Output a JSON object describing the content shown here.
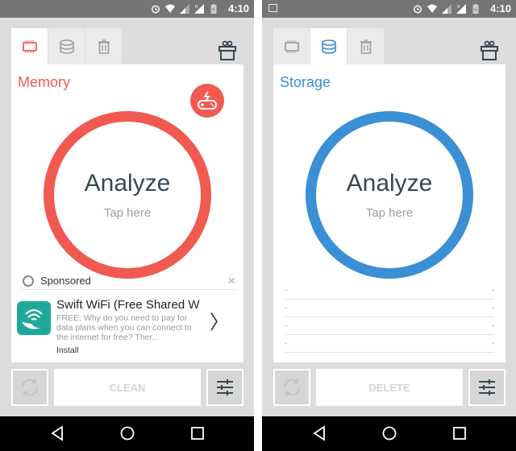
{
  "status_bar": {
    "time": "4:10",
    "battery_level": "26",
    "icons": [
      "alarm-icon",
      "wifi-icon",
      "signal-icon",
      "roaming-signal-icon",
      "battery-icon"
    ]
  },
  "screens": [
    {
      "active_tab": "memory",
      "accent_color": "#f05a50",
      "tabs": [
        {
          "name": "memory",
          "icon": "memory-chip-icon"
        },
        {
          "name": "storage",
          "icon": "database-icon"
        },
        {
          "name": "trash",
          "icon": "trash-icon"
        }
      ],
      "gift_icon": "gift-icon",
      "title": "Memory",
      "game_boost_icon": "game-boost-icon",
      "analyze_label": "Analyze",
      "tap_label": "Tap here",
      "ad": {
        "sponsored_label": "Sponsored",
        "close_label": "×",
        "app_title": "Swift WiFi (Free Shared W",
        "app_desc": "FREE: Why do you need to pay for data plans when you can connect to the internet for free? Ther...",
        "install_label": "Install",
        "chevron": "〉"
      },
      "refresh_icon": "refresh-icon",
      "main_button_label": "CLEAN",
      "settings_icon": "sliders-icon"
    },
    {
      "active_tab": "storage",
      "accent_color": "#3b8fd4",
      "tabs": [
        {
          "name": "memory",
          "icon": "memory-chip-icon"
        },
        {
          "name": "storage",
          "icon": "database-icon"
        },
        {
          "name": "trash",
          "icon": "trash-icon"
        }
      ],
      "gift_icon": "gift-icon",
      "title": "Storage",
      "analyze_label": "Analyze",
      "tap_label": "Tap here",
      "list_rows": [
        {
          "left": "-",
          "right": "-"
        },
        {
          "left": "-",
          "right": "-"
        },
        {
          "left": "-",
          "right": "-"
        },
        {
          "left": "-",
          "right": "-"
        }
      ],
      "refresh_icon": "refresh-icon",
      "main_button_label": "DELETE",
      "settings_icon": "sliders-icon"
    }
  ],
  "nav_bar": {
    "buttons": [
      "back-icon",
      "home-icon",
      "recents-icon"
    ]
  }
}
